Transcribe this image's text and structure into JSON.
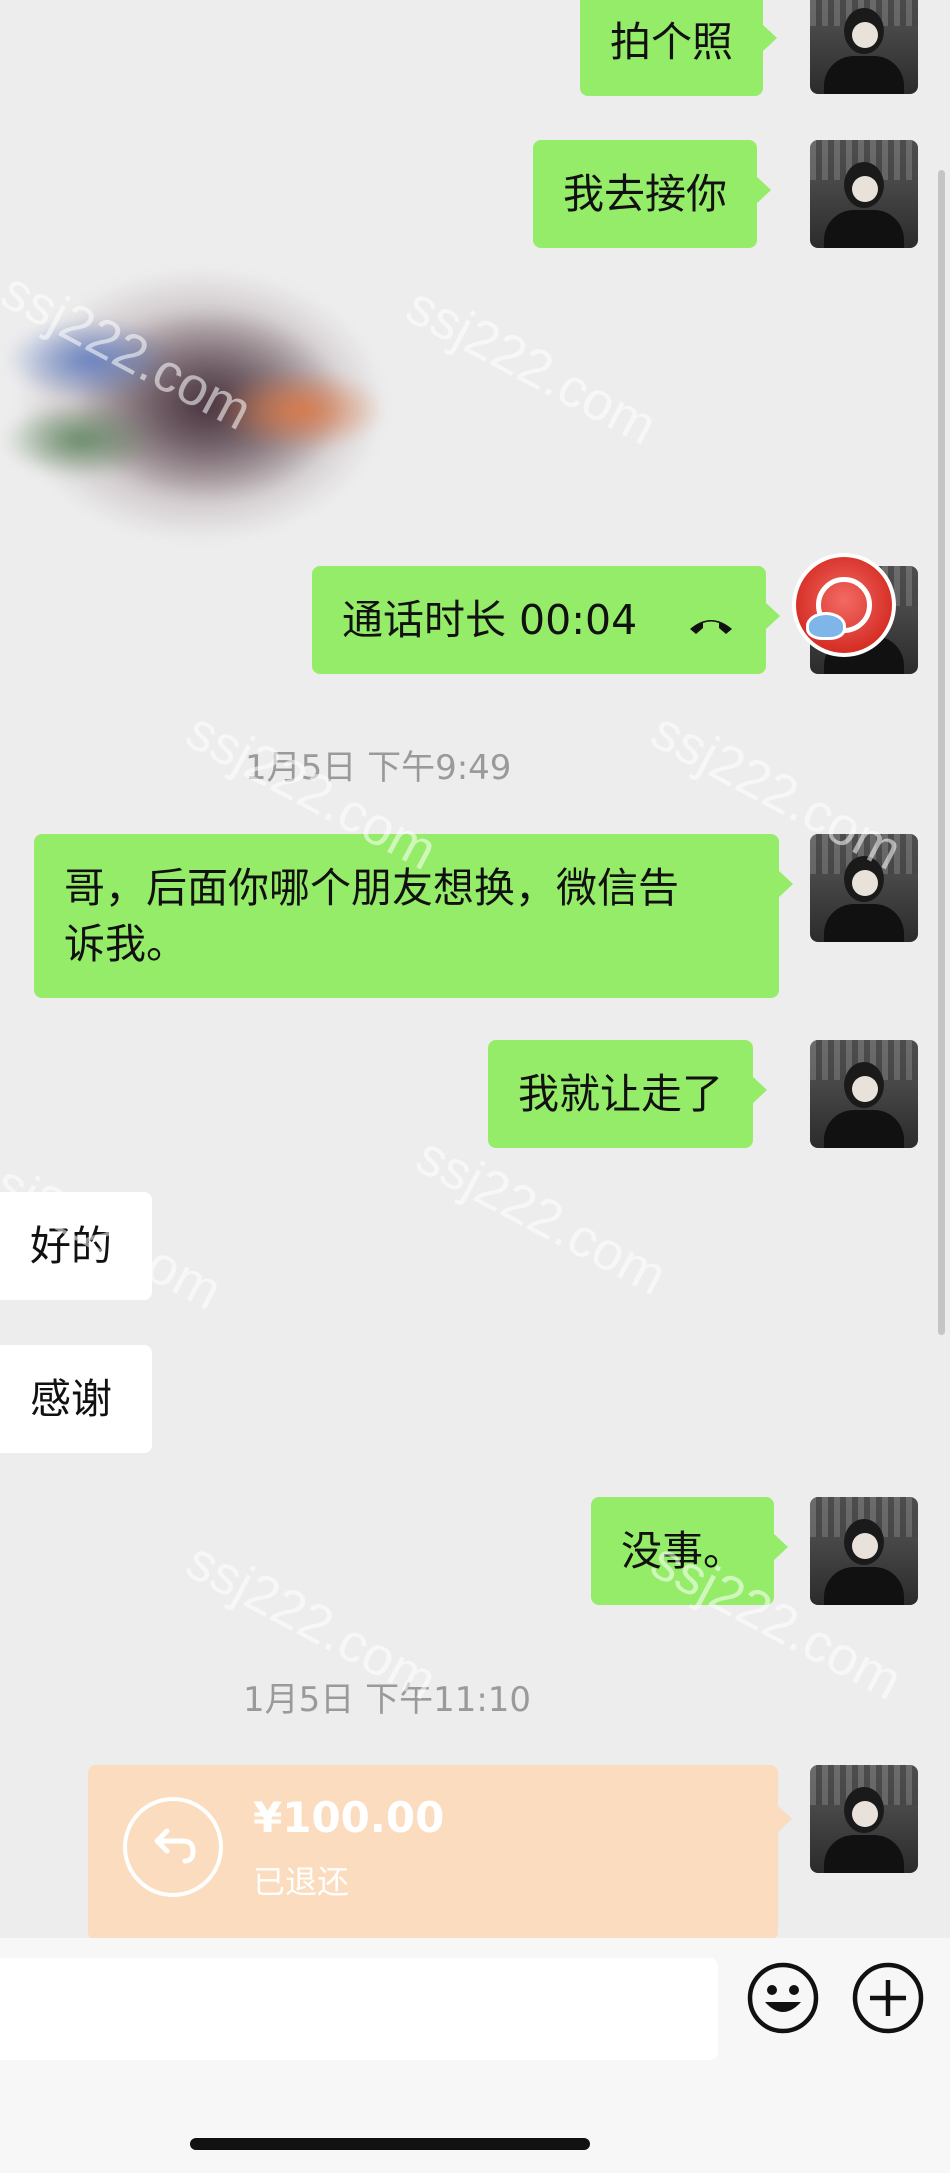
{
  "messages": {
    "m1": "拍个照",
    "m2": "我去接你",
    "call": "通话时长 00:04",
    "m4_line1": "哥，后面你哪个朋友想换，微信告",
    "m4_line2": "诉我。",
    "m5": "我就让走了",
    "r1": "好的",
    "r2": "感谢",
    "m6": "没事。"
  },
  "timestamps": {
    "t1": "1月5日 下午9:49",
    "t2": "1月5日 下午11:10"
  },
  "transfer": {
    "amount": "¥100.00",
    "status": "已退还",
    "icon": "return-arrow-icon",
    "color": "#fbdcbe"
  },
  "watermark": "ssj222.com",
  "colors": {
    "background": "#ededed",
    "sent_bubble": "#95ec69",
    "received_bubble": "#ffffff"
  },
  "input": {
    "emoji_icon": "smiley-icon",
    "plus_icon": "plus-circle-icon"
  }
}
